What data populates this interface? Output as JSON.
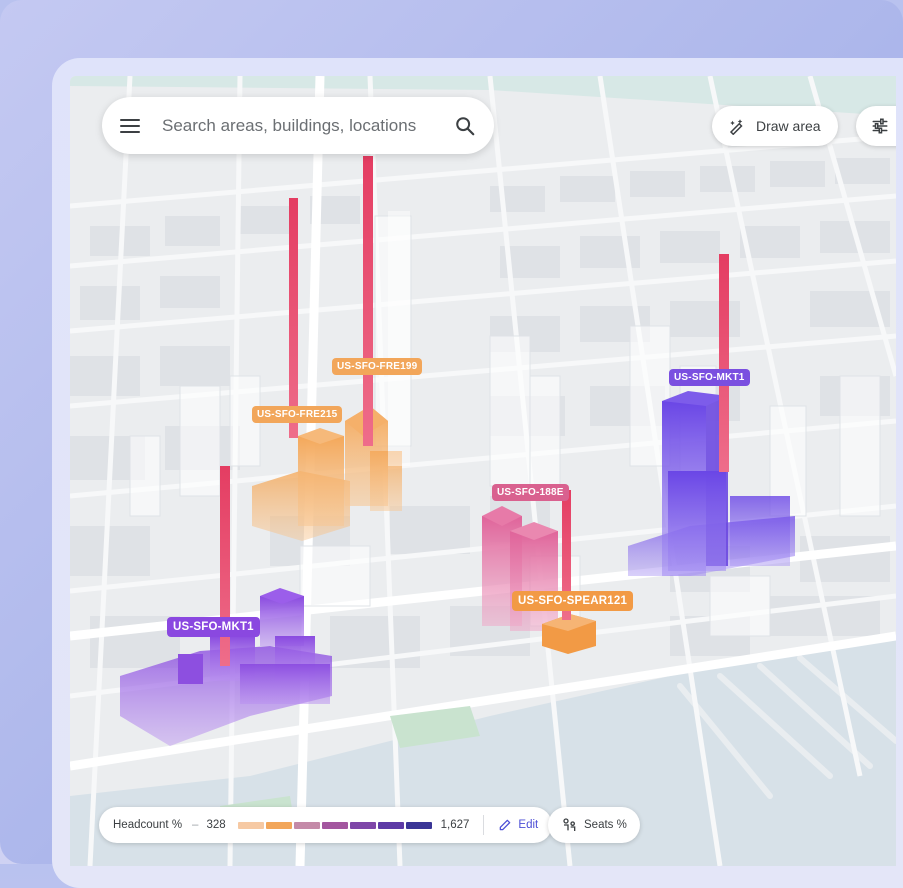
{
  "search": {
    "placeholder": "Search areas, buildings, locations"
  },
  "toolbar": {
    "draw_area_label": "Draw area"
  },
  "buildings": [
    {
      "label": "US-SFO-FRE199",
      "color": "#f2a65a"
    },
    {
      "label": "US-SFO-FRE215",
      "color": "#f2a65a"
    },
    {
      "label": "US-SFO-MKT1",
      "color": "#7a4fe0"
    },
    {
      "label": "US-SFO-188E",
      "color": "#d9618f"
    },
    {
      "label": "US-SFO-SPEAR121",
      "color": "#f29a45"
    },
    {
      "label": "US-SFO-MKT1",
      "color": "#8a48e0"
    }
  ],
  "legend": {
    "metric_label": "Headcount %",
    "dash": "–",
    "min_value": "328",
    "max_value": "1,627",
    "edit_label": "Edit",
    "scale_colors": [
      "#f6c9a3",
      "#f2a65a",
      "#c48aa8",
      "#a3569f",
      "#7e46a8",
      "#5d3aa6",
      "#3a3596"
    ]
  },
  "seats": {
    "label": "Seats %"
  },
  "icons": {
    "menu": "menu-icon",
    "search": "search-icon",
    "draw": "draw-area-icon",
    "filter": "tune-icon",
    "edit": "pencil-icon",
    "seats": "seats-icon"
  }
}
